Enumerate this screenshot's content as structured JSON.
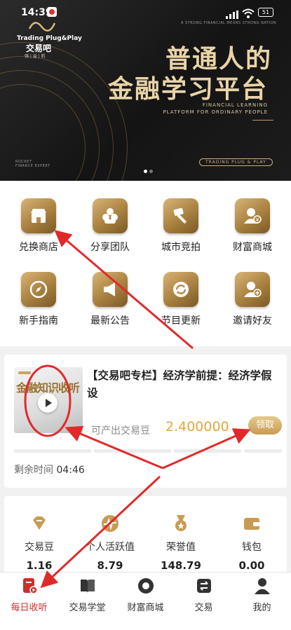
{
  "status_bar": {
    "time": "14:39",
    "battery": "51"
  },
  "banner": {
    "logo_en": "Trading Plug&Play",
    "logo_cn": "交易吧",
    "logo_tag": "强 | 益 | 航",
    "slogan_small": "A STRONG FINANCIAL MEANS STRONG NATION",
    "headline_line1": "普通人的",
    "headline_line2": "金融学习平台",
    "subtitle_line1": "FINANCIAL LEARNING",
    "subtitle_line2": "PLATFORM FOR ORDINARY PEOPLE",
    "corner_text_line1": "ROCKET",
    "corner_text_line2": "FINANCE EXPERT",
    "pill_text": "TRADING PLUG & PLAY"
  },
  "menu": {
    "items": [
      {
        "label": "兑换商店",
        "icon": "shop-icon"
      },
      {
        "label": "分享团队",
        "icon": "team-icon"
      },
      {
        "label": "城市竞拍",
        "icon": "auction-hammer-icon"
      },
      {
        "label": "财富商城",
        "icon": "wealth-user-icon"
      },
      {
        "label": "新手指南",
        "icon": "compass-icon"
      },
      {
        "label": "最新公告",
        "icon": "megaphone-icon"
      },
      {
        "label": "节目更新",
        "icon": "refresh-icon"
      },
      {
        "label": "邀请好友",
        "icon": "invite-user-icon"
      }
    ]
  },
  "article": {
    "thumb_text": "金融知识收听",
    "title": "【交易吧专栏】经济学前提：经济学假设",
    "produce_label": "可产出交易豆",
    "amount": "2.400000",
    "claim_label": "领取",
    "remaining_label": "剩余时间",
    "remaining_time": "04:46"
  },
  "stats": {
    "items": [
      {
        "label": "交易豆",
        "value": "1.16",
        "icon": "diamond-icon"
      },
      {
        "label": "个人活跃值",
        "value": "8.79",
        "icon": "activity-pulse-icon"
      },
      {
        "label": "荣誉值",
        "value": "148.79",
        "icon": "medal-icon"
      },
      {
        "label": "钱包",
        "value": "0.00",
        "icon": "wallet-icon"
      }
    ]
  },
  "tabbar": {
    "items": [
      {
        "label": "每日收听",
        "icon": "daily-listen-icon",
        "active": true
      },
      {
        "label": "交易学堂",
        "icon": "book-icon",
        "active": false
      },
      {
        "label": "财富商城",
        "icon": "store-icon",
        "active": false
      },
      {
        "label": "交易",
        "icon": "exchange-icon",
        "active": false
      },
      {
        "label": "我的",
        "icon": "profile-icon",
        "active": false
      }
    ]
  },
  "colors": {
    "accent_gold": "#c89b52",
    "amount_orange": "#e0a93a",
    "active_red": "#c9302c",
    "annotation_red": "#e02a2a"
  }
}
